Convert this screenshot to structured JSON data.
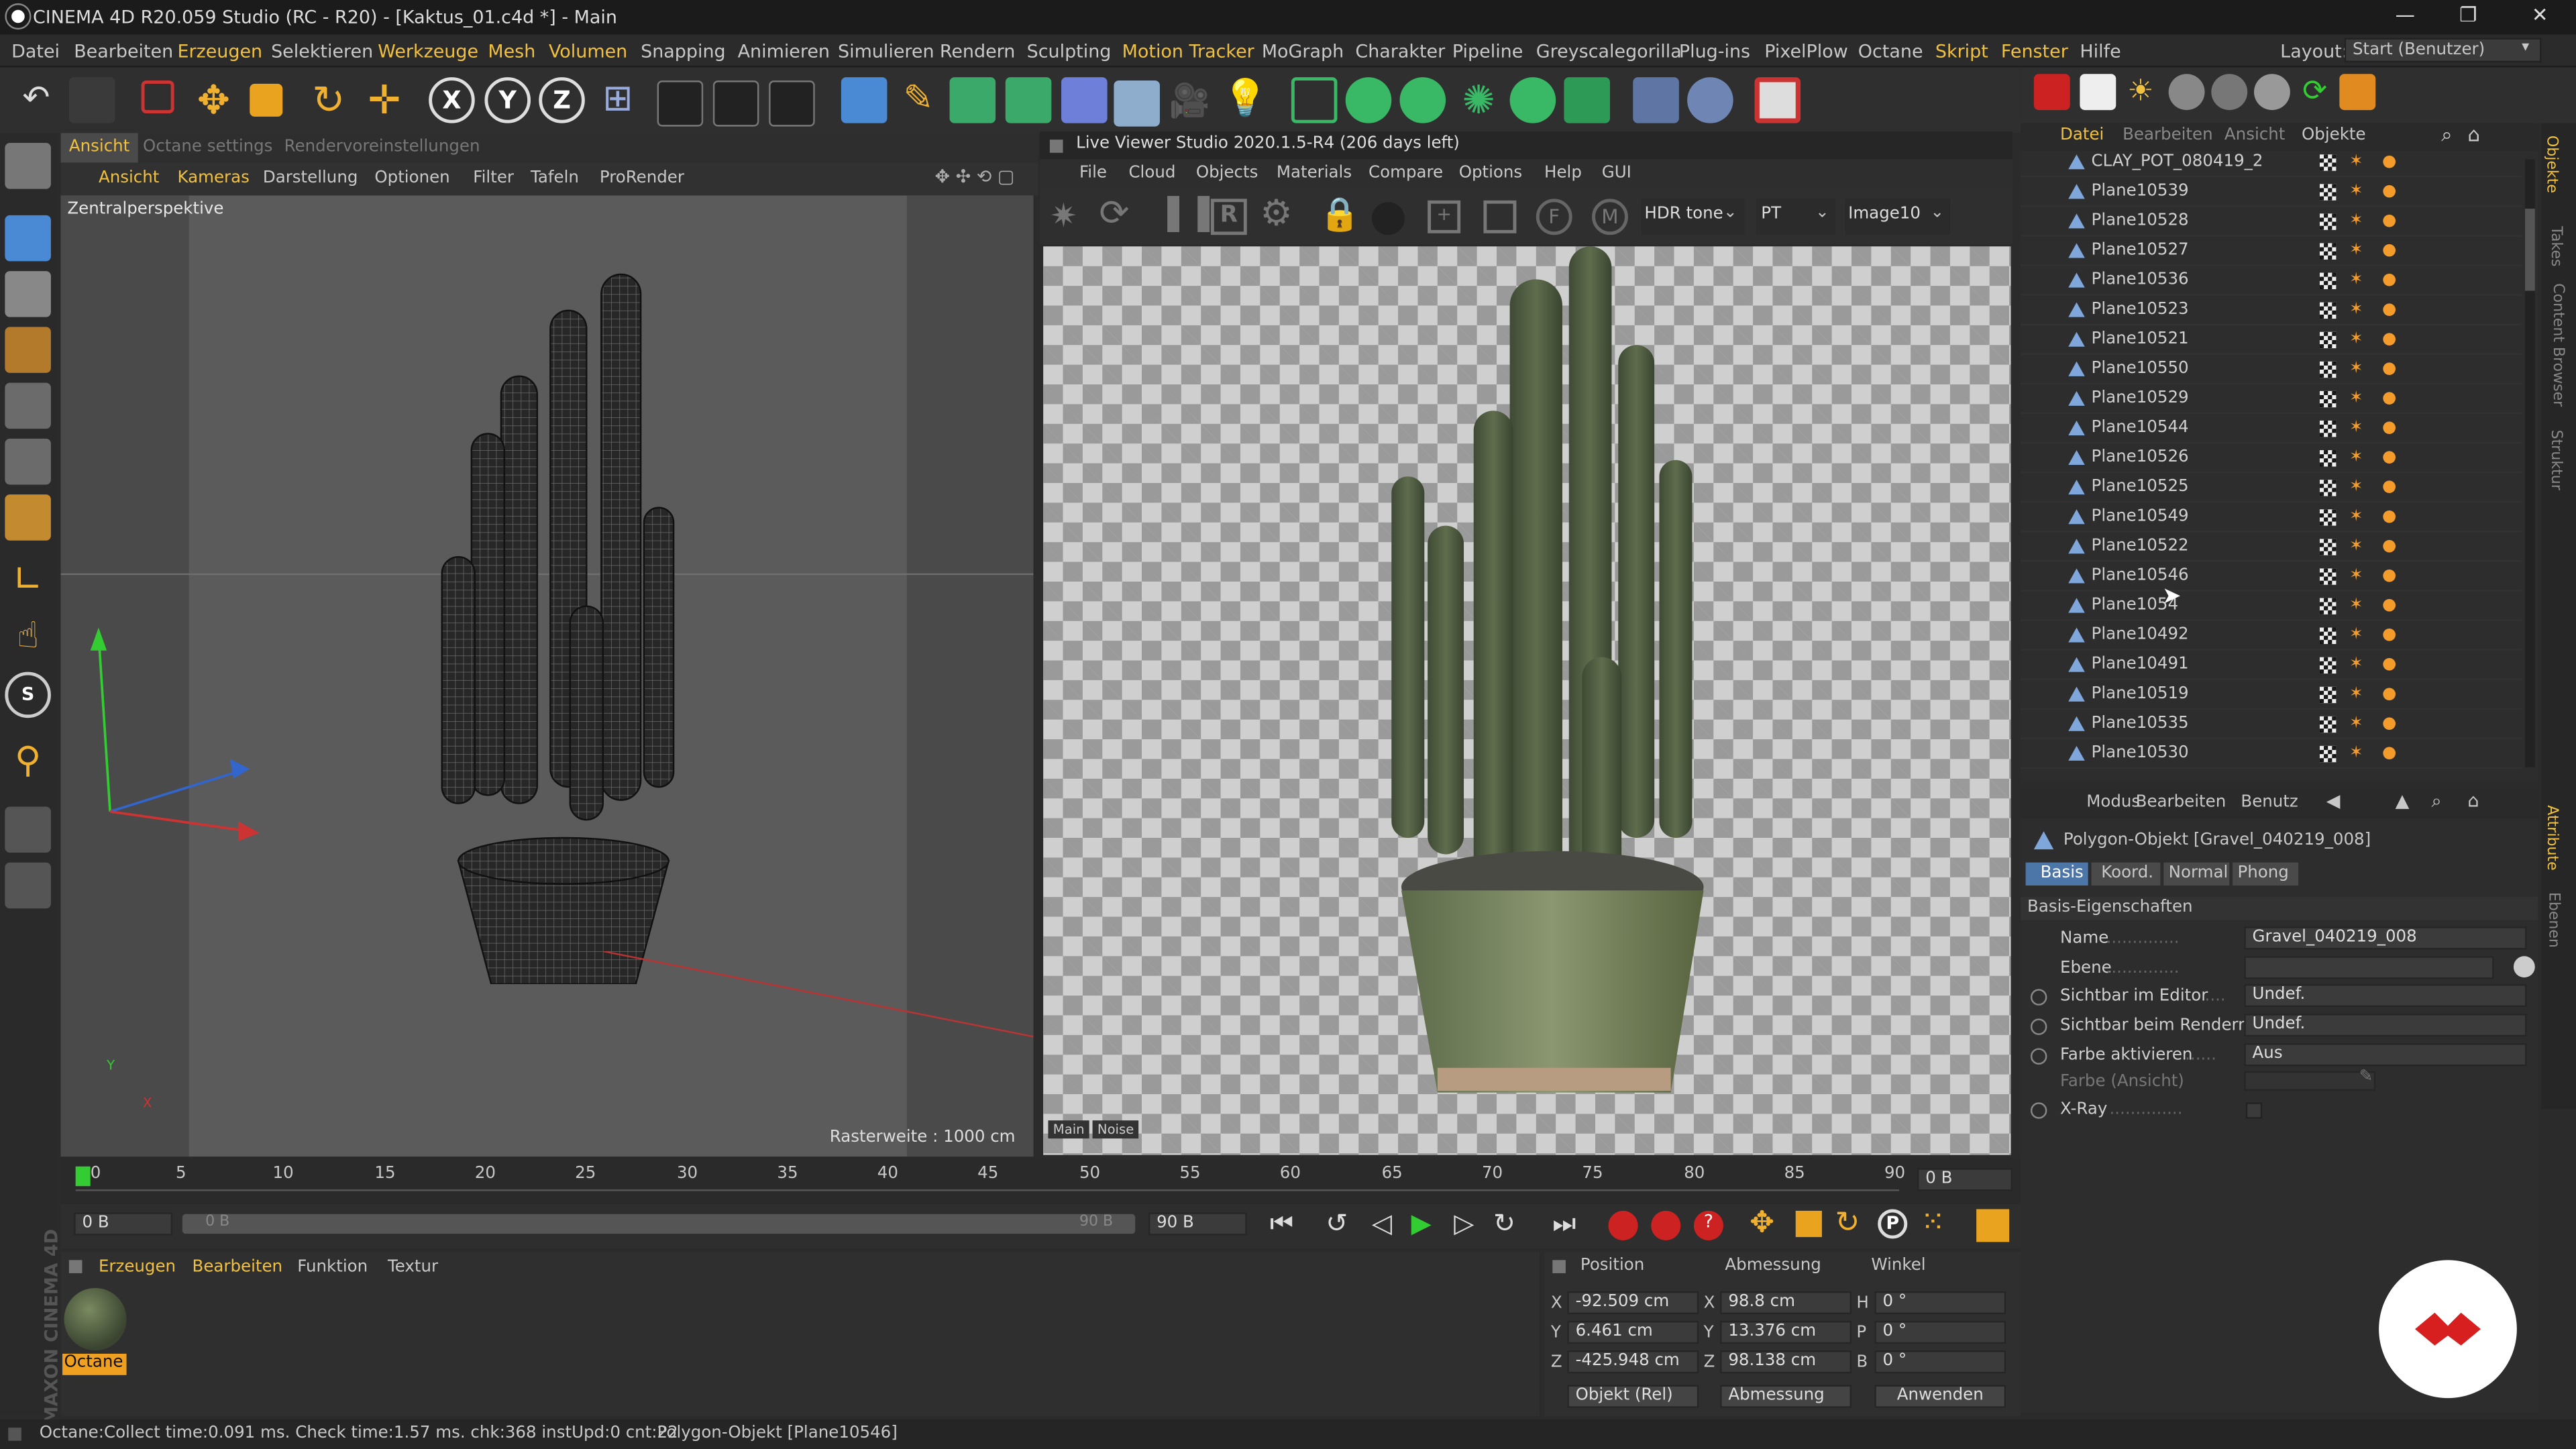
{
  "window": {
    "title": "CINEMA 4D R20.059 Studio (RC - R20) - [Kaktus_01.c4d *] - Main",
    "controls": [
      "—",
      "❐",
      "✕"
    ]
  },
  "menubar": {
    "items": [
      "Datei",
      "Bearbeiten",
      "Erzeugen",
      "Selektieren",
      "Werkzeuge",
      "Mesh",
      "Volumen",
      "Snapping",
      "Animieren",
      "Simulieren",
      "Rendern",
      "Sculpting",
      "Motion Tracker",
      "MoGraph",
      "Charakter",
      "Pipeline",
      "Greyscalegorilla",
      "Plug-ins",
      "PixelPlow",
      "Octane",
      "Skript",
      "Fenster",
      "Hilfe"
    ],
    "layout_label": "Layout:",
    "layout_value": "Start (Benutzer)"
  },
  "viewport": {
    "tabs": [
      "Ansicht",
      "Octane settings",
      "Rendervoreinstellungen"
    ],
    "menu": [
      "Ansicht",
      "Kameras",
      "Darstellung",
      "Optionen",
      "Filter",
      "Tafeln",
      "ProRender"
    ],
    "label": "Zentralperspektive",
    "grid_label": "Rasterweite : 1000 cm",
    "axis_y": "Y",
    "axis_x": "X"
  },
  "live_viewer": {
    "title": "Live Viewer Studio 2020.1.5-R4 (206 days left)",
    "menu": [
      "File",
      "Cloud",
      "Objects",
      "Materials",
      "Compare",
      "Options",
      "Help",
      "GUI"
    ],
    "dropdowns": [
      "HDR tone",
      "PT",
      "Image10"
    ],
    "bottom_tabs": [
      "Main",
      "Noise"
    ]
  },
  "objects": {
    "menu": [
      "Datei",
      "Bearbeiten",
      "Ansicht",
      "Objekte"
    ],
    "rows": [
      "CLAY_POT_080419_2",
      "Plane10539",
      "Plane10528",
      "Plane10527",
      "Plane10536",
      "Plane10523",
      "Plane10521",
      "Plane10550",
      "Plane10529",
      "Plane10544",
      "Plane10526",
      "Plane10525",
      "Plane10549",
      "Plane10522",
      "Plane10546",
      "Plane1054",
      "Plane10492",
      "Plane10491",
      "Plane10519",
      "Plane10535",
      "Plane10530"
    ]
  },
  "side_tabs": [
    "Objekte",
    "Takes",
    "Content Browser",
    "Struktur",
    "Attribute",
    "Ebenen"
  ],
  "attributes": {
    "menu": [
      "Modus",
      "Bearbeiten",
      "Benutz"
    ],
    "object_title": "Polygon-Objekt [Gravel_040219_008]",
    "tabs": [
      "Basis",
      "Koord.",
      "Normal",
      "Phong"
    ],
    "section": "Basis-Eigenschaften",
    "fields": [
      {
        "label": "Name",
        "value": "Gravel_040219_008"
      },
      {
        "label": "Ebene",
        "value": ""
      },
      {
        "label": "Sichtbar im Editor",
        "value": "Undef."
      },
      {
        "label": "Sichtbar beim Rendern",
        "value": "Undef."
      },
      {
        "label": "Farbe aktivieren",
        "value": "Aus"
      },
      {
        "label": "Farbe (Ansicht)",
        "value": ""
      },
      {
        "label": "X-Ray",
        "value": ""
      }
    ]
  },
  "timeline": {
    "ticks": [
      "0",
      "5",
      "10",
      "15",
      "20",
      "25",
      "30",
      "35",
      "40",
      "45",
      "50",
      "55",
      "60",
      "65",
      "70",
      "75",
      "80",
      "85",
      "90"
    ],
    "current_frame": "0 B",
    "start": "0 B",
    "range_start": "0 B",
    "range_end": "90 B",
    "end": "90 B"
  },
  "materials": {
    "menu": [
      "Erzeugen",
      "Bearbeiten",
      "Funktion",
      "Textur"
    ],
    "items": [
      {
        "label": "Octane"
      }
    ]
  },
  "coords": {
    "headers": [
      "Position",
      "Abmessung",
      "Winkel"
    ],
    "position": [
      {
        "axis": "X",
        "value": "-92.509 cm"
      },
      {
        "axis": "Y",
        "value": "6.461 cm"
      },
      {
        "axis": "Z",
        "value": "-425.948 cm"
      }
    ],
    "size": [
      {
        "axis": "X",
        "value": "98.8 cm"
      },
      {
        "axis": "Y",
        "value": "13.376 cm"
      },
      {
        "axis": "Z",
        "value": "98.138 cm"
      }
    ],
    "angle": [
      {
        "axis": "H",
        "value": "0 °"
      },
      {
        "axis": "P",
        "value": "0 °"
      },
      {
        "axis": "B",
        "value": "0 °"
      }
    ],
    "mode": "Objekt (Rel)",
    "size_mode": "Abmessung",
    "apply": "Anwenden"
  },
  "status": {
    "left": "Octane:Collect time:0.091 ms.  Check time:1.57 ms.  chk:368  instUpd:0  cnt:22",
    "right": "Polygon-Objekt [Plane10546]"
  },
  "branding": "MAXON CINEMA 4D",
  "colors": {
    "accent": "#f0c040",
    "selected": "#4d76a8",
    "checker_dark": "#9a9a9a",
    "logo_red": "#d81f1f"
  }
}
